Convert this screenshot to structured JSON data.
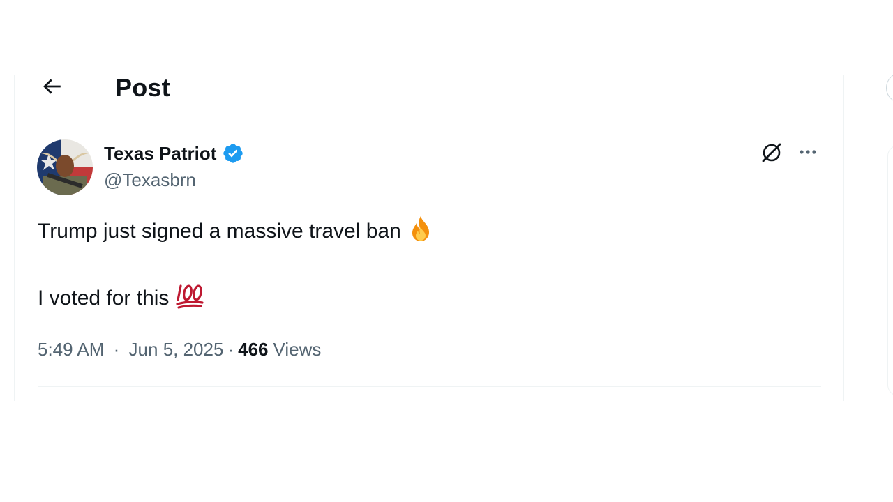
{
  "header": {
    "title": "Post"
  },
  "post": {
    "author": {
      "display_name": "Texas Patriot",
      "handle": "@Texasbrn",
      "verified": true
    },
    "lines": [
      "Trump just signed a massive travel ban",
      "I voted for this"
    ],
    "emojis": [
      "fire",
      "hundred-points"
    ],
    "time": "5:49 AM",
    "separator": "·",
    "date": "Jun 5, 2025",
    "views_count": "466",
    "views_label": "Views"
  },
  "icons": {
    "back": "arrow-left-icon",
    "verified": "verified-badge-icon",
    "grok": "grok-icon",
    "more": "more-dots-icon"
  },
  "colors": {
    "text_primary": "#0f1419",
    "text_secondary": "#536471",
    "verified_blue": "#1d9bf0",
    "border": "#eff3f4"
  }
}
